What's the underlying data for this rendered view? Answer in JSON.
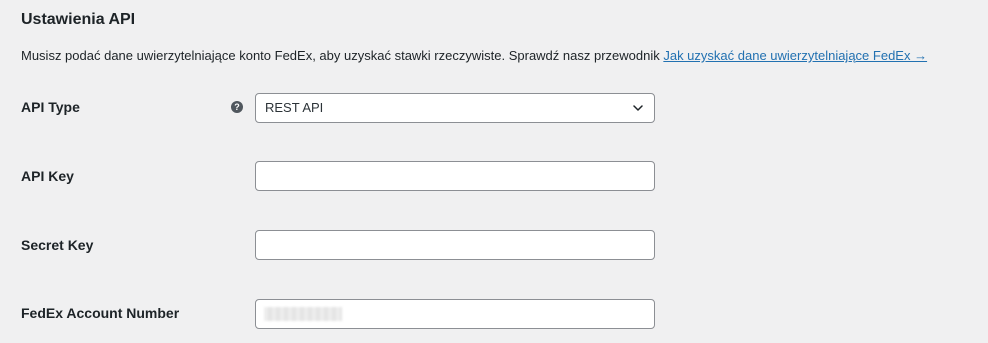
{
  "section": {
    "title": "Ustawienia API",
    "description": "Musisz podać dane uwierzytelniające konto FedEx, aby uzyskać stawki rzeczywiste. Sprawdź nasz przewodnik ",
    "link_text": "Jak uzyskać dane uwierzytelniające FedEx →"
  },
  "fields": {
    "api_type": {
      "label": "API Type",
      "help_icon": "question-circle-icon",
      "selected": "REST API"
    },
    "api_key": {
      "label": "API Key",
      "value": ""
    },
    "secret_key": {
      "label": "Secret Key",
      "value": ""
    },
    "account_number": {
      "label": "FedEx Account Number"
    }
  }
}
